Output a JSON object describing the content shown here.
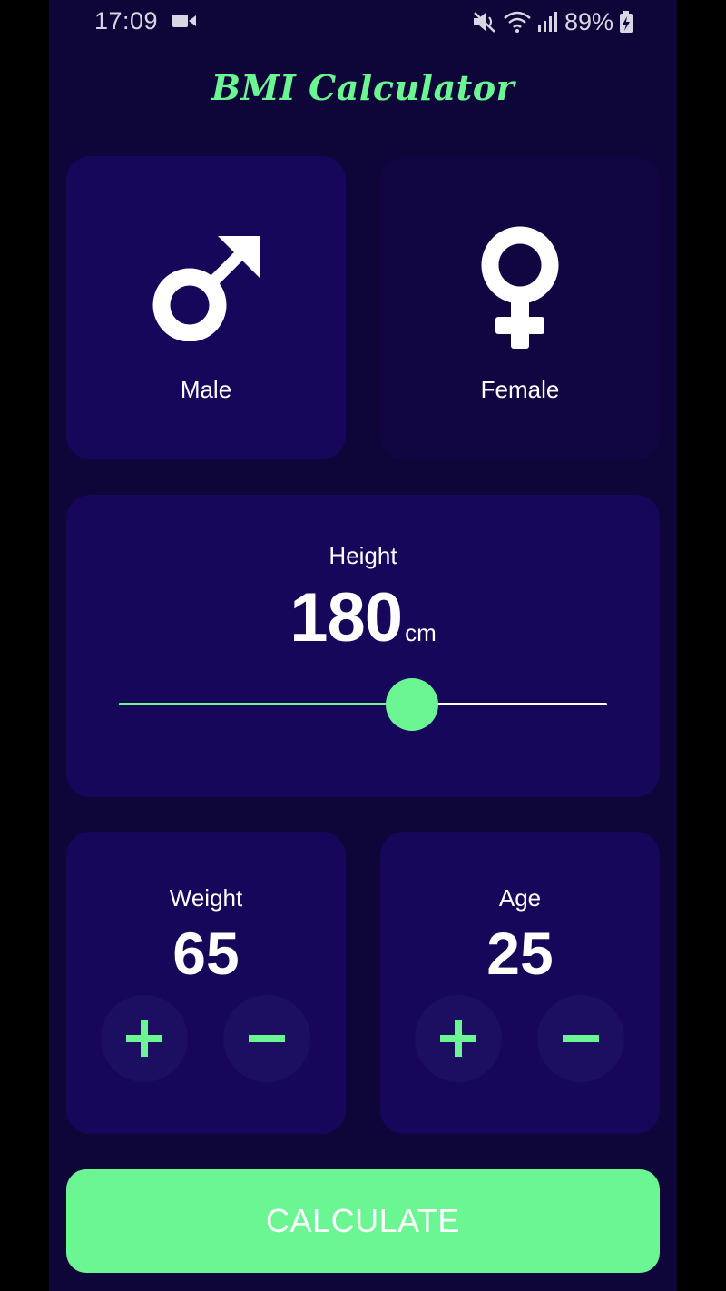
{
  "status_bar": {
    "time": "17:09",
    "battery": "89%",
    "icons": [
      "video-icon",
      "mute-icon",
      "wifi-icon",
      "signal-icon",
      "battery-charging-icon"
    ]
  },
  "app": {
    "title": "BMI Calculator"
  },
  "colors": {
    "background": "#0e0538",
    "card_active": "#16075a",
    "card_inactive": "#120642",
    "accent": "#6bf593",
    "text": "#ffffff"
  },
  "gender": {
    "selected": "male",
    "male_label": "Male",
    "female_label": "Female",
    "male_icon": "male-symbol-icon",
    "female_icon": "female-symbol-icon"
  },
  "height": {
    "label": "Height",
    "value": "180",
    "unit": "cm",
    "fraction": 0.6
  },
  "weight": {
    "label": "Weight",
    "value": "65"
  },
  "age": {
    "label": "Age",
    "value": "25"
  },
  "controls": {
    "plus_icon": "plus-icon",
    "minus_icon": "minus-icon"
  },
  "calculate_label": "CALCULATE"
}
